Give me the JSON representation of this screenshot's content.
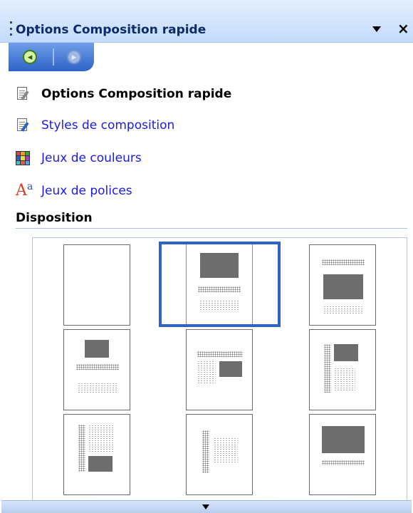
{
  "pane": {
    "title": "Options Composition rapide"
  },
  "tasks": [
    {
      "label": "Options Composition rapide",
      "icon": "quick-publication-icon",
      "style": "bold"
    },
    {
      "label": "Styles de composition",
      "icon": "publication-designs-icon",
      "style": "link"
    },
    {
      "label": "Jeux de couleurs",
      "icon": "color-schemes-icon",
      "style": "link"
    },
    {
      "label": "Jeux de polices",
      "icon": "font-schemes-icon",
      "style": "link"
    }
  ],
  "section": {
    "title": "Disposition"
  },
  "layouts": {
    "count": 9,
    "selected_index": 1
  },
  "colors": {
    "link": "#1a1aef",
    "title_text": "#0d2a6a",
    "selection": "#2f62c8"
  }
}
